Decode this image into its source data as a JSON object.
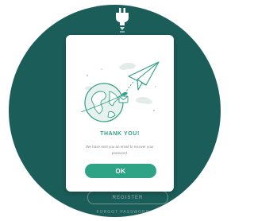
{
  "modal": {
    "title": "THANK YOU!",
    "message": "We have sent you an email to recover your password.",
    "ok_label": "OK"
  },
  "background": {
    "register_label": "REGISTER",
    "forgot_label": "FORGOT PASSWORD"
  },
  "colors": {
    "background_circle": "#1b5d59",
    "accent": "#2fa386",
    "title": "#2f9e86"
  },
  "icons": {
    "top": "plug-icon",
    "illustration": "paper-plane-globe-illustration"
  }
}
